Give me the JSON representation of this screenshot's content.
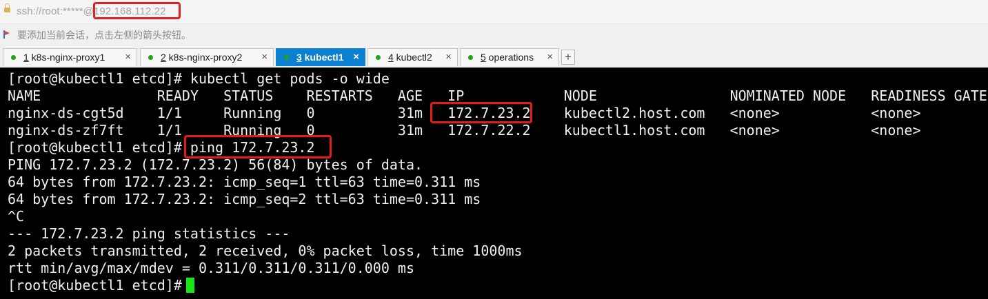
{
  "address": {
    "url": "ssh://root:*****@192.168.112.22"
  },
  "hint": {
    "text": "要添加当前会话，点击左侧的箭头按钮。"
  },
  "tabs": [
    {
      "num": "1",
      "label": " k8s-nginx-proxy1",
      "active": false
    },
    {
      "num": "2",
      "label": " k8s-nginx-proxy2",
      "active": false
    },
    {
      "num": "3",
      "label": " kubectl1",
      "active": true
    },
    {
      "num": "4",
      "label": " kubectl2",
      "active": false
    },
    {
      "num": "5",
      "label": " operations",
      "active": false
    }
  ],
  "tab_close_glyph": "×",
  "add_tab_glyph": "+",
  "terminal": {
    "lines": [
      "[root@kubectl1 etcd]# kubectl get pods -o wide",
      "NAME              READY   STATUS    RESTARTS   AGE   IP            NODE                NOMINATED NODE   READINESS GATES",
      "nginx-ds-cgt5d    1/1     Running   0          31m   172.7.23.2    kubectl2.host.com   <none>           <none>",
      "nginx-ds-zf7ft    1/1     Running   0          31m   172.7.22.2    kubectl1.host.com   <none>           <none>",
      "[root@kubectl1 etcd]# ping 172.7.23.2",
      "PING 172.7.23.2 (172.7.23.2) 56(84) bytes of data.",
      "64 bytes from 172.7.23.2: icmp_seq=1 ttl=63 time=0.311 ms",
      "64 bytes from 172.7.23.2: icmp_seq=2 ttl=63 time=0.311 ms",
      "^C",
      "--- 172.7.23.2 ping statistics ---",
      "2 packets transmitted, 2 received, 0% packet loss, time 1000ms",
      "rtt min/avg/max/mdev = 0.311/0.311/0.311/0.000 ms",
      "[root@kubectl1 etcd]#"
    ]
  },
  "colors": {
    "active_tab": "#0b7fd0",
    "status_dot": "#1aa51a",
    "cursor": "#19e619",
    "highlight": "#e51a1a"
  }
}
